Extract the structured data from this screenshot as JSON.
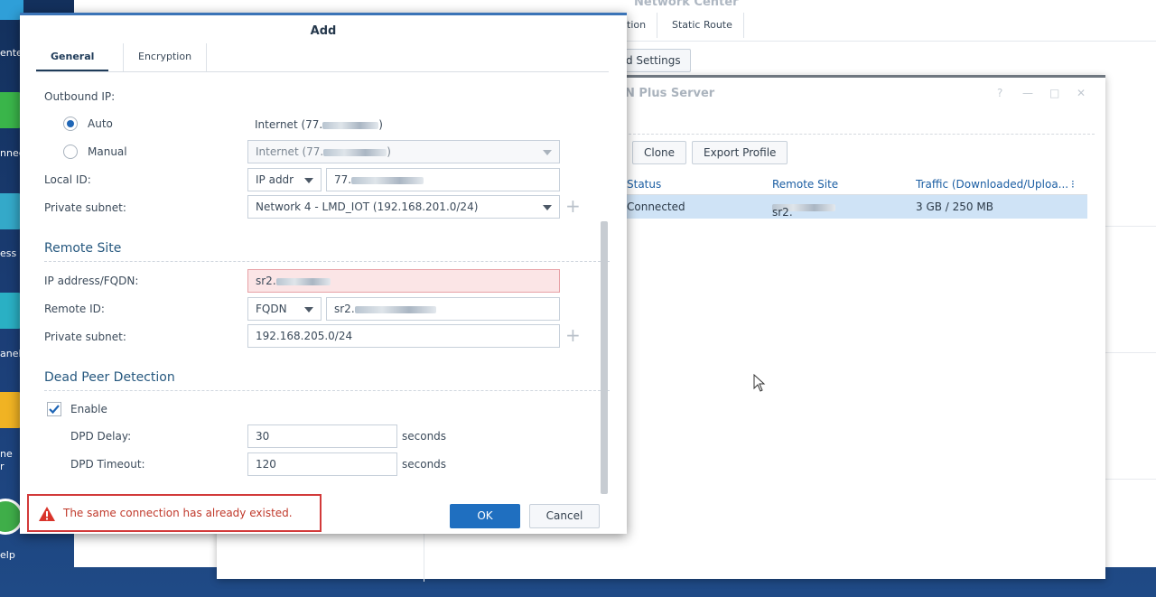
{
  "desktop": {
    "labels": [
      "ente",
      "nnec",
      "ess",
      "anel",
      "ne",
      "r",
      "elp"
    ],
    "colors": {
      "icon1": "#2f9fd8",
      "icon2": "#3ab54a",
      "icon3": "#34a9c9",
      "icon4": "#2ab0c4",
      "icon5": "#f0b323",
      "icon6": "#3fae49"
    }
  },
  "network_center": {
    "title": "Network Center",
    "tabs": [
      "tion",
      "Static Route"
    ],
    "button": "d Settings"
  },
  "vpn_window": {
    "title": "N Plus Server",
    "controls": {
      "help": "?",
      "minimize": "—",
      "maximize": "□",
      "close": "✕"
    },
    "toolbar": {
      "clone": "Clone",
      "export": "Export Profile"
    },
    "grid": {
      "headers": [
        "Status",
        "Remote Site",
        "Traffic (Downloaded/Uploa..."
      ],
      "menu": "⁝",
      "row": {
        "status": "Connected",
        "remote_site": "sr2.",
        "traffic": "3 GB / 250 MB"
      }
    }
  },
  "dialog": {
    "title": "Add",
    "tabs": {
      "general": "General",
      "encryption": "Encryption"
    },
    "outbound_ip": {
      "label": "Outbound IP:",
      "auto_label": "Auto",
      "auto_value": "Internet (77.",
      "auto_value_end": ")",
      "manual_label": "Manual",
      "manual_value": "Internet (77.",
      "manual_value_end": ")",
      "selected": "Auto"
    },
    "local_id": {
      "label": "Local ID:",
      "type": "IP addr",
      "value": "77."
    },
    "private_subnet_local": {
      "label": "Private subnet:",
      "value": "Network 4 - LMD_IOT (192.168.201.0/24)"
    },
    "remote_site": {
      "heading": "Remote Site",
      "ip_label": "IP address/FQDN:",
      "ip_value": "sr2.",
      "remote_id_label": "Remote ID:",
      "remote_id_type": "FQDN",
      "remote_id_value": "sr2.",
      "subnet_label": "Private subnet:",
      "subnet_value": "192.168.205.0/24"
    },
    "dpd": {
      "heading": "Dead Peer Detection",
      "enable_label": "Enable",
      "enabled": true,
      "delay_label": "DPD Delay:",
      "delay_value": "30",
      "timeout_label": "DPD Timeout:",
      "timeout_value": "120",
      "unit": "seconds"
    },
    "error_message": "The same connection has already existed.",
    "ok": "OK",
    "cancel": "Cancel"
  }
}
